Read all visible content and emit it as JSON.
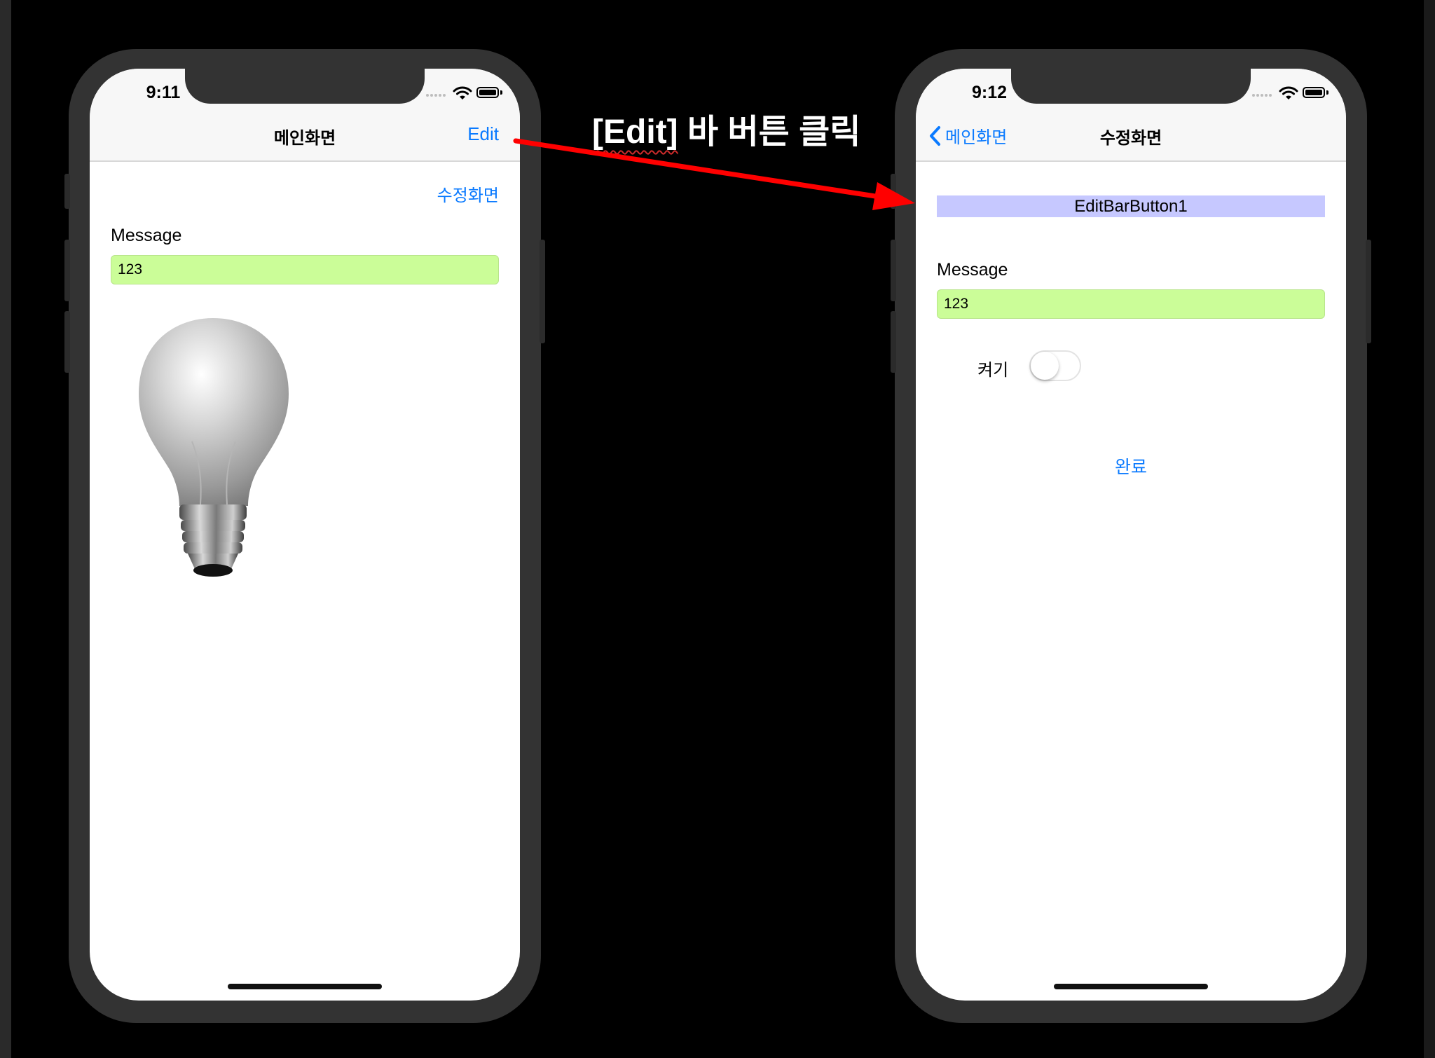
{
  "annotation": {
    "text_edit": "[Edit]",
    "text_rest": " 바 버튼 클릭",
    "arrow_color": "#ff0000"
  },
  "left_screen": {
    "time": "9:11",
    "nav_title": "메인화면",
    "nav_right_button": "Edit",
    "edit_screen_link": "수정화면",
    "message_label": "Message",
    "message_value": "123",
    "image": "lightbulb-off"
  },
  "right_screen": {
    "time": "9:12",
    "back_label": "메인화면",
    "nav_title": "수정화면",
    "bar_button_label": "EditBarButton1",
    "message_label": "Message",
    "message_value": "123",
    "switch_label": "켜기",
    "switch_on": false,
    "done_button": "완료"
  },
  "colors": {
    "accent": "#0a7aff",
    "field_background": "#cbfd98",
    "bar_button_background": "#c6c8ff",
    "phone_frame": "#333333"
  }
}
